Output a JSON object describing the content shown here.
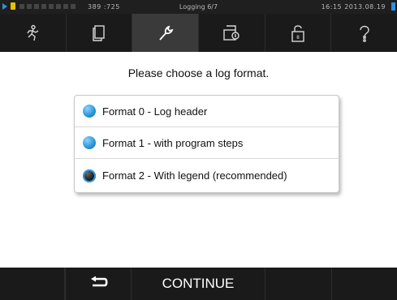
{
  "status": {
    "counter": "389 :725",
    "title": "Logging 6/7",
    "datetime": "16:15  2013.08.19"
  },
  "toolbar": {
    "icons": [
      "run-icon",
      "document-icon",
      "wrench-icon",
      "log-print-icon",
      "lock-icon",
      "help-icon"
    ],
    "active": "wrench-icon"
  },
  "main": {
    "prompt": "Please choose a log format.",
    "options": [
      {
        "label": "Format 0 - Log header",
        "selected": false
      },
      {
        "label": "Format 1 - with program steps",
        "selected": false
      },
      {
        "label": "Format 2 - With legend (recommended)",
        "selected": true
      }
    ]
  },
  "bottom": {
    "continue_label": "CONTINUE"
  },
  "colors": {
    "accent": "#2e9ad8",
    "bar_background": "#1a1a1a"
  }
}
